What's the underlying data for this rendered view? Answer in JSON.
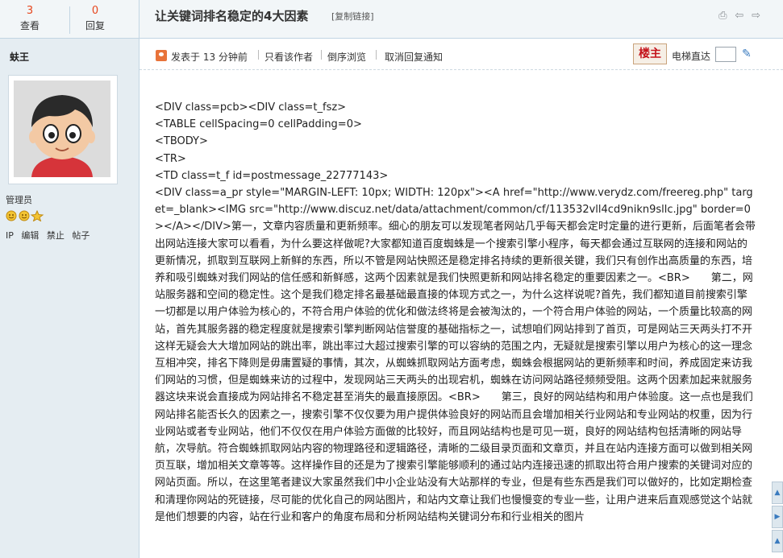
{
  "stats": {
    "views_value": "3",
    "views_label": "查看",
    "replies_value": "0",
    "replies_label": "回复"
  },
  "author": {
    "name": "蚨王",
    "group": "管理员",
    "actions": [
      "IP",
      "编辑",
      "禁止",
      "帖子"
    ]
  },
  "thread": {
    "title": "让关键词排名稳定的4大因素",
    "copy_link": "[复制链接]",
    "icons": [
      "print-icon",
      "prev-thread-icon",
      "next-thread-icon"
    ]
  },
  "post_header": {
    "posted_at": "发表于 13 分钟前",
    "only_author": "只看该作者",
    "reverse_view": "倒序浏览",
    "cancel_notify": "取消回复通知",
    "floor_badge": "楼主",
    "elevator_label": "电梯直达",
    "elevator_value": ""
  },
  "content": {
    "body": "<DIV class=pcb><DIV class=t_fsz>\n<TABLE cellSpacing=0 cellPadding=0>\n<TBODY>\n<TR>\n<TD class=t_f id=postmessage_22777143>\n<DIV class=a_pr style=\"MARGIN-LEFT: 10px; WIDTH: 120px\"><A href=\"http://www.verydz.com/freereg.php\" target=_blank><IMG src=\"http://www.discuz.net/data/attachment/common/cf/113532vll4cd9nikn9sllc.jpg\" border=0></A></DIV>第一，文章内容质量和更新频率。细心的朋友可以发现笔者网站几乎每天都会定时定量的进行更新，后面笔者会带出网站连接大家可以看看，为什么要这样做呢?大家都知道百度蜘蛛是一个搜索引擎小程序，每天都会通过互联网的连接和网站的更新情况，抓取到互联网上新鲜的东西，所以不管是网站快照还是稳定排名持续的更新很关键，我们只有创作出高质量的东西，培养和吸引蜘蛛对我们网站的信任感和新鲜感，这两个因素就是我们快照更新和网站排名稳定的重要因素之一。<BR>　　第二，网站服务器和空间的稳定性。这个是我们稳定排名最基础最直接的体现方式之一，为什么这样说呢?首先，我们都知道目前搜索引擎一切都是以用户体验为核心的，不符合用户体验的优化和做法终将是会被淘汰的，一个符合用户体验的网站，一个质量比较高的网站，首先其服务器的稳定程度就是搜索引擎判断网站信誉度的基础指标之一，试想咱们网站排到了首页，可是网站三天两头打不开这样无疑会大大增加网站的跳出率，跳出率过大超过搜索引擎的可以容纳的范围之内，无疑就是搜索引擎以用户为核心的这一理念互相冲突，排名下降则是毋庸置疑的事情，其次，从蜘蛛抓取网站方面考虑，蜘蛛会根据网站的更新频率和时间，养成固定来访我们网站的习惯，但是蜘蛛来访的过程中，发现网站三天两头的出现宕机，蜘蛛在访问网站路径频频受阻。这两个因素加起来就服务器这块来说会直接成为网站排名不稳定甚至消失的最直接原因。<BR>　　第三，良好的网站结构和用户体验度。这一点也是我们网站排名能否长久的因素之一，搜索引擎不仅仅要为用户提供体验良好的网站而且会增加相关行业网站和专业网站的权重，因为行业网站或者专业网站，他们不仅仅在用户体验方面做的比较好，而且网站结构也是可见一斑，良好的网站结构包括清晰的网站导航，次导航。符合蜘蛛抓取网站内容的物理路径和逻辑路径，清晰的二级目录页面和文章页，并且在站内连接方面可以做到相关网页互联，增加相关文章等等。这样操作目的还是为了搜索引擎能够顺利的通过站内连接迅速的抓取出符合用户搜索的关键词对应的网站页面。所以，在这里笔者建议大家虽然我们中小企业站没有大站那样的专业，但是有些东西是我们可以做好的，比如定期检查和清理你网站的死链接，尽可能的优化自己的网站图片，和站内文章让我们也慢慢变的专业一些，让用户进来后直观感觉这个站就是他们想要的内容，站在行业和客户的角度布局和分析网站结构关键词分布和行业相关的图片"
  },
  "colors": {
    "panel_bg": "#e5edf2",
    "bar_bg": "#f2f6f8",
    "border": "#c2d5e3",
    "stat_number": "#e6461d",
    "floor_badge": "#c4121a"
  }
}
